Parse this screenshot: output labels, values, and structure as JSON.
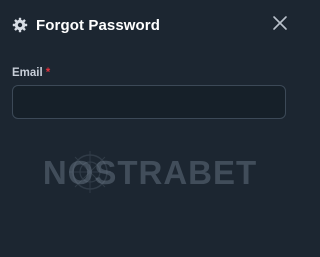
{
  "modal": {
    "title": "Forgot Password",
    "title_icon": "gear-icon",
    "close_icon": "close-icon"
  },
  "form": {
    "email_label": "Email",
    "required_mark": "*",
    "email_value": "",
    "email_placeholder": ""
  },
  "watermark": {
    "text": "NOSTRABET"
  },
  "colors": {
    "background": "#1c2631",
    "input_background": "#162029",
    "input_border": "#3c4957",
    "required": "#e0323d",
    "title": "#ffffff",
    "label": "#c7ced8"
  }
}
